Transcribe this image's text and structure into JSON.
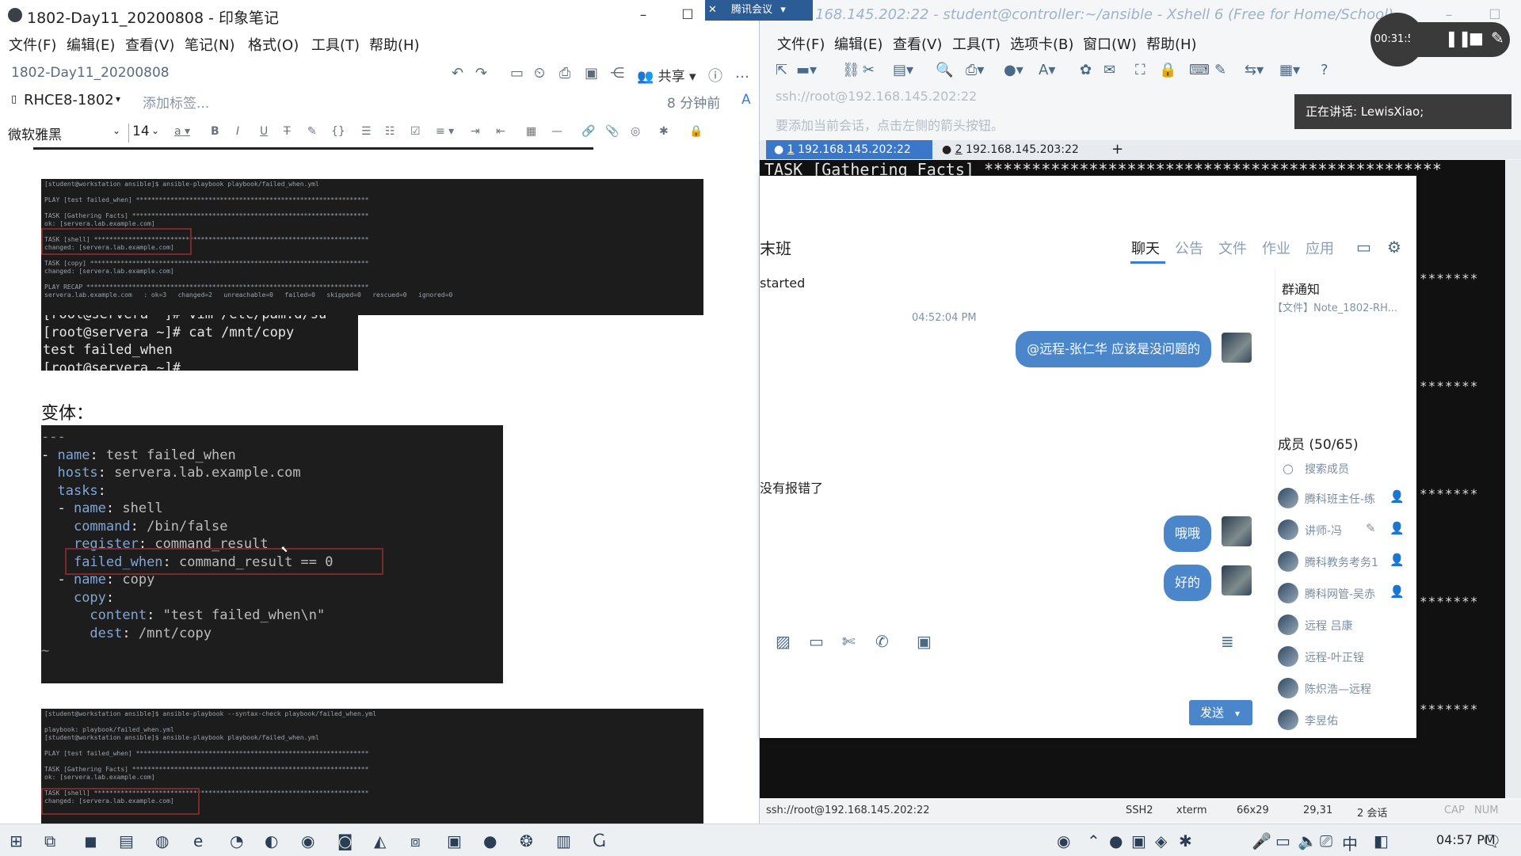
{
  "evernote": {
    "window_title": "1802-Day11_20200808 - 印象笔记",
    "menu": [
      "文件(F)",
      "编辑(E)",
      "查看(V)",
      "笔记(N)",
      "格式(O)",
      "工具(T)",
      "帮助(H)"
    ],
    "note_title": "1802-Day11_20200808",
    "share_label": "共享",
    "notebook": "RHCE8-1802",
    "add_tag": "添加标签...",
    "modified": "8 分钟前",
    "font": "微软雅黑",
    "font_size": "14",
    "screenshot1_lines": [
      "[student@workstation ansible]$ ansible-playbook playbook/failed_when.yml",
      "",
      "PLAY [test failed_when] *************************************************************",
      "",
      "TASK [Gathering Facts] **************************************************************",
      "ok: [servera.lab.example.com]",
      "",
      "TASK [shell] ************************************************************************",
      "changed: [servera.lab.example.com]",
      "",
      "TASK [copy] *************************************************************************",
      "changed: [servera.lab.example.com]",
      "",
      "PLAY RECAP **************************************************************************",
      "servera.lab.example.com   : ok=3   changed=2   unreachable=0   failed=0   skipped=0   rescued=0   ignored=0"
    ],
    "screenshot2_lines": [
      "[root@servera ~]# vim /etc/pam.d/su",
      "[root@servera ~]# cat /mnt/copy",
      "test failed_when",
      "[root@servera ~]#"
    ],
    "variant_label": "变体：",
    "yaml_lines": [
      {
        "text": "---",
        "cls": "dim"
      },
      {
        "text": "- ",
        "key": "name",
        "val": " test failed_when"
      },
      {
        "text": "  ",
        "key": "hosts",
        "val": " servera.lab.example.com"
      },
      {
        "text": "  ",
        "key": "tasks",
        "val": ""
      },
      {
        "text": "  - ",
        "key": "name",
        "val": " shell"
      },
      {
        "text": "    ",
        "key": "command",
        "val": " /bin/false"
      },
      {
        "text": "    ",
        "key": "register",
        "val": " command_result"
      },
      {
        "text": "    ",
        "key": "failed_when",
        "val": " command_result == 0"
      },
      {
        "text": "  - ",
        "key": "name",
        "val": " copy"
      },
      {
        "text": "    ",
        "key": "copy",
        "val": ""
      },
      {
        "text": "      ",
        "key": "content",
        "val": " \"test failed_when\\n\""
      },
      {
        "text": "      ",
        "key": "dest",
        "val": " /mnt/copy"
      },
      {
        "text": "~",
        "cls": "dim"
      }
    ],
    "screenshot3_lines": [
      "[student@workstation ansible]$ ansible-playbook --syntax-check playbook/failed_when.yml",
      "",
      "playbook: playbook/failed_when.yml",
      "[student@workstation ansible]$ ansible-playbook playbook/failed_when.yml",
      "",
      "PLAY [test failed_when] *************************************************************",
      "",
      "TASK [Gathering Facts] **************************************************************",
      "ok: [servera.lab.example.com]",
      "",
      "TASK [shell] ************************************************************************",
      "changed: [servera.lab.example.com]"
    ]
  },
  "xshell": {
    "window_title": "168.145.202:22 - student@controller:~/ansible - Xshell 6 (Free for Home/School)",
    "menu": [
      "文件(F)",
      "编辑(E)",
      "查看(V)",
      "工具(T)",
      "选项卡(B)",
      "窗口(W)",
      "帮助(H)"
    ],
    "address": "ssh://root@192.168.145.202:22",
    "tip": "要添加当前会话，点击左侧的箭头按钮。",
    "tabs": [
      {
        "num": "1",
        "label": "192.168.145.202:22",
        "active": true
      },
      {
        "num": "2",
        "label": "192.168.145.203:22",
        "active": false
      }
    ],
    "add_tab": "+",
    "term_first_line": "TASK [Gathering Facts] ************************************************",
    "stars": "*******",
    "status": {
      "connection": "ssh://root@192.168.145.202:22",
      "protocol": "SSH2",
      "term": "xterm",
      "size": "66x29",
      "cursor": "29,31",
      "sessions": "2 会话",
      "caps": "CAP",
      "num": "NUM"
    }
  },
  "meeting": {
    "button": "腾讯会议",
    "timer": "00:31:54",
    "speaking": "正在讲话: LewisXiao;"
  },
  "chat": {
    "class_name": "末班",
    "tabs": [
      "聊天",
      "公告",
      "文件",
      "作业",
      "应用"
    ],
    "active_tab": "聊天",
    "partial_msg1": "started",
    "timestamp": "04:52:04 PM",
    "messages": [
      {
        "text": "@远程-张仁华 应该是没问题的"
      },
      {
        "text": "哦哦"
      },
      {
        "text": "好的"
      }
    ],
    "partial_msg2": "没有报错了",
    "notice_title": "群通知",
    "notice_file": "【文件】Note_1802-RH...",
    "members_title": "成员 (50/65)",
    "search_members": "搜索成员",
    "members": [
      "腾科班主任-练",
      "讲师-冯",
      "腾科教务考务1",
      "腾科网管-吴赤",
      "远程 吕康",
      "远程-叶正锃",
      "陈炽浩—远程",
      "李昱佑"
    ],
    "send_label": "发送"
  },
  "taskbar": {
    "clock": "04:57 PM"
  }
}
